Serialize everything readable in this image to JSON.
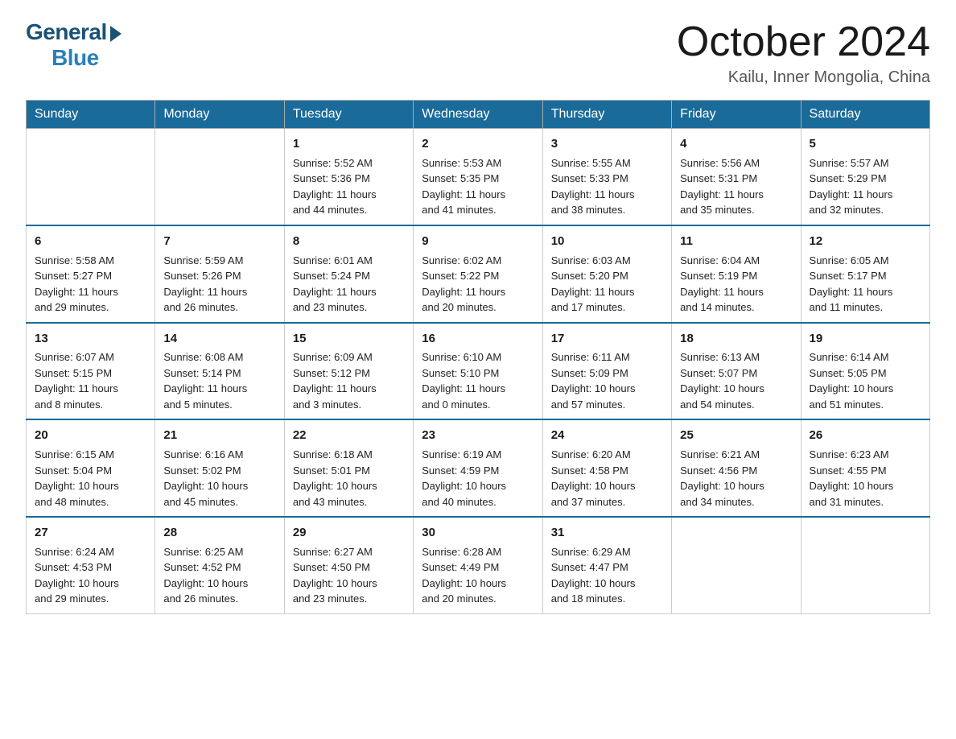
{
  "logo": {
    "general": "General",
    "blue": "Blue"
  },
  "title": "October 2024",
  "location": "Kailu, Inner Mongolia, China",
  "days_of_week": [
    "Sunday",
    "Monday",
    "Tuesday",
    "Wednesday",
    "Thursday",
    "Friday",
    "Saturday"
  ],
  "weeks": [
    [
      {
        "day": "",
        "info": ""
      },
      {
        "day": "",
        "info": ""
      },
      {
        "day": "1",
        "info": "Sunrise: 5:52 AM\nSunset: 5:36 PM\nDaylight: 11 hours\nand 44 minutes."
      },
      {
        "day": "2",
        "info": "Sunrise: 5:53 AM\nSunset: 5:35 PM\nDaylight: 11 hours\nand 41 minutes."
      },
      {
        "day": "3",
        "info": "Sunrise: 5:55 AM\nSunset: 5:33 PM\nDaylight: 11 hours\nand 38 minutes."
      },
      {
        "day": "4",
        "info": "Sunrise: 5:56 AM\nSunset: 5:31 PM\nDaylight: 11 hours\nand 35 minutes."
      },
      {
        "day": "5",
        "info": "Sunrise: 5:57 AM\nSunset: 5:29 PM\nDaylight: 11 hours\nand 32 minutes."
      }
    ],
    [
      {
        "day": "6",
        "info": "Sunrise: 5:58 AM\nSunset: 5:27 PM\nDaylight: 11 hours\nand 29 minutes."
      },
      {
        "day": "7",
        "info": "Sunrise: 5:59 AM\nSunset: 5:26 PM\nDaylight: 11 hours\nand 26 minutes."
      },
      {
        "day": "8",
        "info": "Sunrise: 6:01 AM\nSunset: 5:24 PM\nDaylight: 11 hours\nand 23 minutes."
      },
      {
        "day": "9",
        "info": "Sunrise: 6:02 AM\nSunset: 5:22 PM\nDaylight: 11 hours\nand 20 minutes."
      },
      {
        "day": "10",
        "info": "Sunrise: 6:03 AM\nSunset: 5:20 PM\nDaylight: 11 hours\nand 17 minutes."
      },
      {
        "day": "11",
        "info": "Sunrise: 6:04 AM\nSunset: 5:19 PM\nDaylight: 11 hours\nand 14 minutes."
      },
      {
        "day": "12",
        "info": "Sunrise: 6:05 AM\nSunset: 5:17 PM\nDaylight: 11 hours\nand 11 minutes."
      }
    ],
    [
      {
        "day": "13",
        "info": "Sunrise: 6:07 AM\nSunset: 5:15 PM\nDaylight: 11 hours\nand 8 minutes."
      },
      {
        "day": "14",
        "info": "Sunrise: 6:08 AM\nSunset: 5:14 PM\nDaylight: 11 hours\nand 5 minutes."
      },
      {
        "day": "15",
        "info": "Sunrise: 6:09 AM\nSunset: 5:12 PM\nDaylight: 11 hours\nand 3 minutes."
      },
      {
        "day": "16",
        "info": "Sunrise: 6:10 AM\nSunset: 5:10 PM\nDaylight: 11 hours\nand 0 minutes."
      },
      {
        "day": "17",
        "info": "Sunrise: 6:11 AM\nSunset: 5:09 PM\nDaylight: 10 hours\nand 57 minutes."
      },
      {
        "day": "18",
        "info": "Sunrise: 6:13 AM\nSunset: 5:07 PM\nDaylight: 10 hours\nand 54 minutes."
      },
      {
        "day": "19",
        "info": "Sunrise: 6:14 AM\nSunset: 5:05 PM\nDaylight: 10 hours\nand 51 minutes."
      }
    ],
    [
      {
        "day": "20",
        "info": "Sunrise: 6:15 AM\nSunset: 5:04 PM\nDaylight: 10 hours\nand 48 minutes."
      },
      {
        "day": "21",
        "info": "Sunrise: 6:16 AM\nSunset: 5:02 PM\nDaylight: 10 hours\nand 45 minutes."
      },
      {
        "day": "22",
        "info": "Sunrise: 6:18 AM\nSunset: 5:01 PM\nDaylight: 10 hours\nand 43 minutes."
      },
      {
        "day": "23",
        "info": "Sunrise: 6:19 AM\nSunset: 4:59 PM\nDaylight: 10 hours\nand 40 minutes."
      },
      {
        "day": "24",
        "info": "Sunrise: 6:20 AM\nSunset: 4:58 PM\nDaylight: 10 hours\nand 37 minutes."
      },
      {
        "day": "25",
        "info": "Sunrise: 6:21 AM\nSunset: 4:56 PM\nDaylight: 10 hours\nand 34 minutes."
      },
      {
        "day": "26",
        "info": "Sunrise: 6:23 AM\nSunset: 4:55 PM\nDaylight: 10 hours\nand 31 minutes."
      }
    ],
    [
      {
        "day": "27",
        "info": "Sunrise: 6:24 AM\nSunset: 4:53 PM\nDaylight: 10 hours\nand 29 minutes."
      },
      {
        "day": "28",
        "info": "Sunrise: 6:25 AM\nSunset: 4:52 PM\nDaylight: 10 hours\nand 26 minutes."
      },
      {
        "day": "29",
        "info": "Sunrise: 6:27 AM\nSunset: 4:50 PM\nDaylight: 10 hours\nand 23 minutes."
      },
      {
        "day": "30",
        "info": "Sunrise: 6:28 AM\nSunset: 4:49 PM\nDaylight: 10 hours\nand 20 minutes."
      },
      {
        "day": "31",
        "info": "Sunrise: 6:29 AM\nSunset: 4:47 PM\nDaylight: 10 hours\nand 18 minutes."
      },
      {
        "day": "",
        "info": ""
      },
      {
        "day": "",
        "info": ""
      }
    ]
  ]
}
